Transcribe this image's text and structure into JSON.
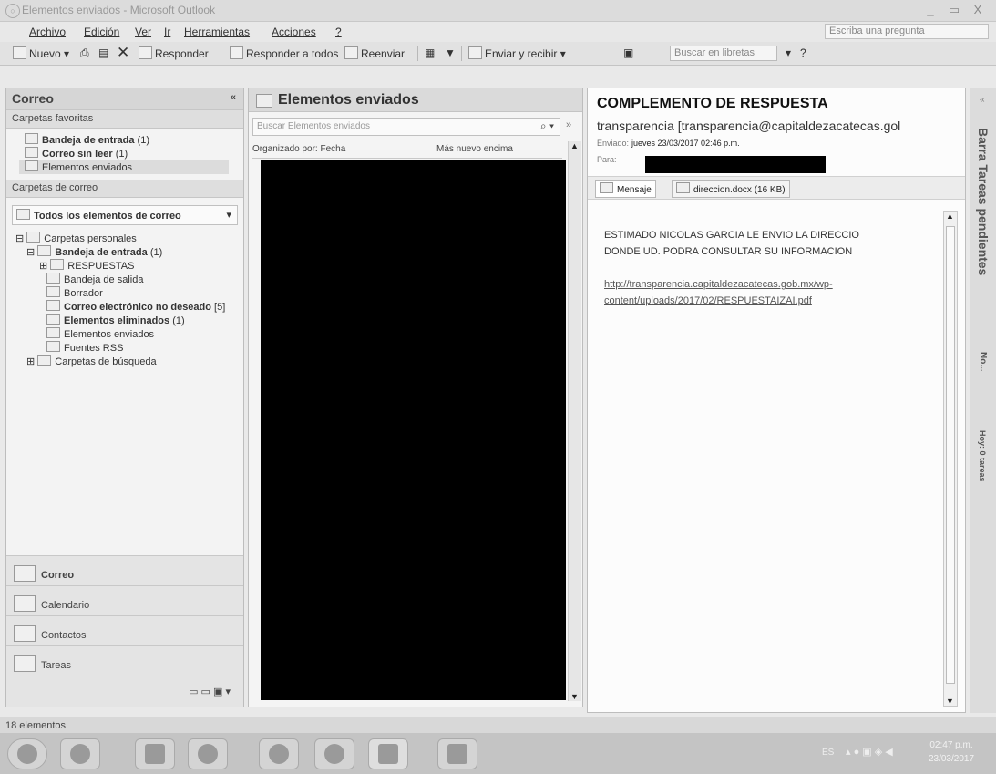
{
  "window": {
    "title": "Elementos enviados - Microsoft Outlook",
    "controls": [
      "_",
      "▭",
      "X"
    ]
  },
  "menu": {
    "items": [
      "Archivo",
      "Edición",
      "Ver",
      "Ir",
      "Herramientas",
      "Acciones",
      "?"
    ],
    "ask_placeholder": "Escriba una pregunta"
  },
  "toolbar": {
    "new": "Nuevo",
    "reply": "Responder",
    "reply_all": "Responder a todos",
    "forward": "Reenviar",
    "send_receive": "Enviar y recibir",
    "search_books_placeholder": "Buscar en libretas"
  },
  "nav": {
    "title": "Correo",
    "favorites_header": "Carpetas favoritas",
    "favorites": [
      {
        "label": "Bandeja de entrada",
        "count": "(1)"
      },
      {
        "label": "Correo sin leer",
        "count": "(1)"
      },
      {
        "label": "Elementos enviados",
        "count": ""
      }
    ],
    "mail_folders_header": "Carpetas de correo",
    "all_items": "Todos los elementos de correo",
    "tree": [
      {
        "label": "Carpetas personales",
        "count": ""
      },
      {
        "label": "Bandeja de entrada",
        "count": "(1)"
      },
      {
        "label": "RESPUESTAS",
        "count": ""
      },
      {
        "label": "Bandeja de salida",
        "count": ""
      },
      {
        "label": "Borrador",
        "count": ""
      },
      {
        "label": "Correo electrónico no deseado",
        "count": "[5]"
      },
      {
        "label": "Elementos eliminados",
        "count": "(1)"
      },
      {
        "label": "Elementos enviados",
        "count": ""
      },
      {
        "label": "Fuentes RSS",
        "count": ""
      },
      {
        "label": "Carpetas de búsqueda",
        "count": ""
      }
    ],
    "buttons": [
      "Correo",
      "Calendario",
      "Contactos",
      "Tareas"
    ]
  },
  "list": {
    "title": "Elementos enviados",
    "search_placeholder": "Buscar Elementos enviados",
    "arranged_by": "Organizado por: Fecha",
    "sort_order": "Más nuevo encima"
  },
  "message": {
    "subject": "COMPLEMENTO DE RESPUESTA",
    "from": "transparencia [transparencia@capitaldezacatecas.gol",
    "sent_label": "Enviado:",
    "sent_value": "jueves 23/03/2017 02:46 p.m.",
    "to_label": "Para:",
    "tab_message": "Mensaje",
    "attachment": "direccion.docx (16 KB)",
    "body_line1": "ESTIMADO NICOLAS GARCIA LE ENVIO LA DIRECCIO",
    "body_line2": "DONDE UD. PODRA CONSULTAR SU INFORMACION",
    "link_line1": "http://transparencia.capitaldezacatecas.gob.mx/wp-",
    "link_line2": "content/uploads/2017/02/RESPUESTAIZAI.pdf"
  },
  "todo_bar": {
    "title": "Barra Tareas pendientes",
    "item1": "No...",
    "item2": "Hoy: 0 tareas"
  },
  "status": {
    "text": "18 elementos"
  },
  "taskbar": {
    "time": "02:47 p.m.",
    "date": "23/03/2017",
    "lang": "ES"
  }
}
